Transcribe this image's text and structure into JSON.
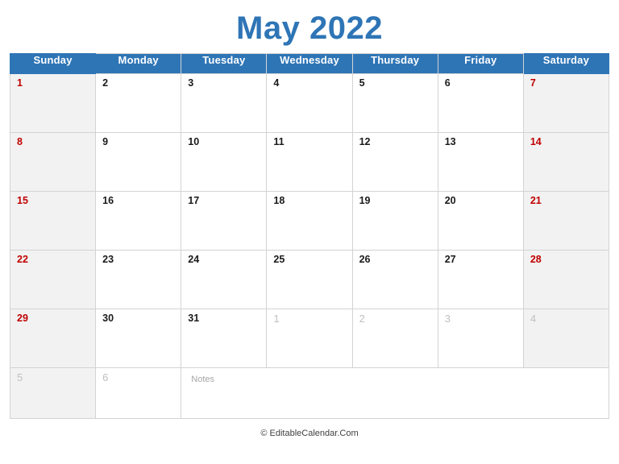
{
  "title": "May 2022",
  "weekdays": [
    {
      "label": "Sunday",
      "weekend": true
    },
    {
      "label": "Monday",
      "weekend": false
    },
    {
      "label": "Tuesday",
      "weekend": false
    },
    {
      "label": "Wednesday",
      "weekend": false
    },
    {
      "label": "Thursday",
      "weekend": false
    },
    {
      "label": "Friday",
      "weekend": false
    },
    {
      "label": "Saturday",
      "weekend": true
    }
  ],
  "weeks": [
    {
      "days": [
        {
          "num": "1",
          "style": "red"
        },
        {
          "num": "2",
          "style": "normal"
        },
        {
          "num": "3",
          "style": "normal"
        },
        {
          "num": "4",
          "style": "normal"
        },
        {
          "num": "5",
          "style": "normal"
        },
        {
          "num": "6",
          "style": "normal"
        },
        {
          "num": "7",
          "style": "red"
        }
      ]
    },
    {
      "days": [
        {
          "num": "8",
          "style": "red"
        },
        {
          "num": "9",
          "style": "normal"
        },
        {
          "num": "10",
          "style": "normal"
        },
        {
          "num": "11",
          "style": "normal"
        },
        {
          "num": "12",
          "style": "normal"
        },
        {
          "num": "13",
          "style": "normal"
        },
        {
          "num": "14",
          "style": "red"
        }
      ]
    },
    {
      "days": [
        {
          "num": "15",
          "style": "red"
        },
        {
          "num": "16",
          "style": "normal"
        },
        {
          "num": "17",
          "style": "normal"
        },
        {
          "num": "18",
          "style": "normal"
        },
        {
          "num": "19",
          "style": "normal"
        },
        {
          "num": "20",
          "style": "normal"
        },
        {
          "num": "21",
          "style": "red"
        }
      ]
    },
    {
      "days": [
        {
          "num": "22",
          "style": "red"
        },
        {
          "num": "23",
          "style": "normal"
        },
        {
          "num": "24",
          "style": "normal"
        },
        {
          "num": "25",
          "style": "normal"
        },
        {
          "num": "26",
          "style": "normal"
        },
        {
          "num": "27",
          "style": "normal"
        },
        {
          "num": "28",
          "style": "red"
        }
      ]
    },
    {
      "days": [
        {
          "num": "29",
          "style": "red"
        },
        {
          "num": "30",
          "style": "normal"
        },
        {
          "num": "31",
          "style": "normal"
        },
        {
          "num": "1",
          "style": "muted"
        },
        {
          "num": "2",
          "style": "muted"
        },
        {
          "num": "3",
          "style": "muted"
        },
        {
          "num": "4",
          "style": "muted"
        }
      ]
    }
  ],
  "notes_row": {
    "day_sunday": "5",
    "day_monday": "6",
    "notes_label": "Notes"
  },
  "footer": "© EditableCalendar.Com",
  "colors": {
    "header_blue": "#2E75B6",
    "weekend_red": "#C00000",
    "muted_gray": "#BFBFBF",
    "weekend_bg": "#F2F2F2",
    "grid_line": "#D3D3D3"
  }
}
